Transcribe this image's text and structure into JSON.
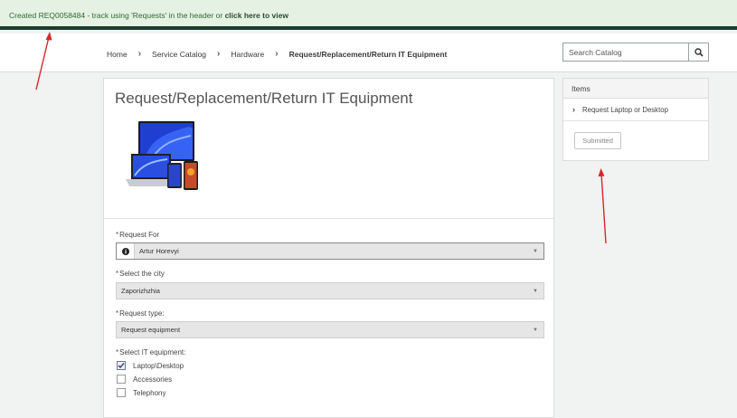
{
  "banner": {
    "message": "Created REQ0058484 - track using 'Requests' in the header or ",
    "link": "click here to view"
  },
  "breadcrumbs": [
    "Home",
    "Service Catalog",
    "Hardware",
    "Request/Replacement/Return IT Equipment"
  ],
  "search": {
    "placeholder": "Search Catalog"
  },
  "form": {
    "title": "Request/Replacement/Return IT Equipment",
    "request_for": {
      "label": "Request For",
      "value": "Artur Horevyi"
    },
    "city": {
      "label": "Select the city",
      "value": "Zaporizhzhia"
    },
    "request_type": {
      "label": "Request type:",
      "value": "Request equipment"
    },
    "equipment": {
      "label": "Select IT equipment:",
      "options": [
        {
          "label": "Laptop\\Desktop",
          "checked": true
        },
        {
          "label": "Accessories",
          "checked": false
        },
        {
          "label": "Telephony",
          "checked": false
        }
      ]
    }
  },
  "items_panel": {
    "title": "Items",
    "item": "Request Laptop or Desktop",
    "button": "Submitted"
  },
  "colors": {
    "annotation_arrow": "#d9262b",
    "banner_border": "#1b3b2e",
    "banner_bg": "#e4f1e3"
  }
}
